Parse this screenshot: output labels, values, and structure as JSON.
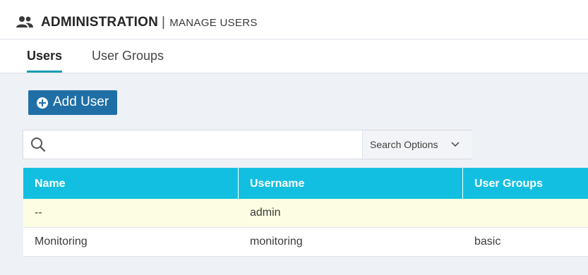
{
  "header": {
    "title": "ADMINISTRATION",
    "separator": "|",
    "subtitle": "MANAGE USERS",
    "icon": "users-icon"
  },
  "tabs": [
    {
      "label": "Users",
      "active": true
    },
    {
      "label": "User Groups",
      "active": false
    }
  ],
  "toolbar": {
    "add_user_label": "Add User",
    "add_icon": "plus-circle-icon"
  },
  "search": {
    "value": "",
    "placeholder": "",
    "options_label": "Search Options"
  },
  "table": {
    "columns": [
      "Name",
      "Username",
      "User Groups"
    ],
    "rows": [
      {
        "name": "--",
        "username": "admin",
        "user_groups": ""
      },
      {
        "name": "Monitoring",
        "username": "monitoring",
        "user_groups": "basic"
      }
    ]
  },
  "colors": {
    "accent": "#13bfe0",
    "button": "#1f6fa6",
    "tab_underline": "#1a9cb5",
    "highlight_row": "#fdfde3"
  }
}
